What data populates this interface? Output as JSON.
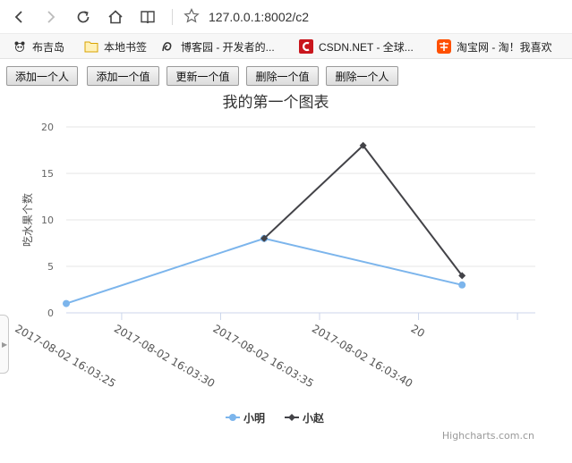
{
  "browser": {
    "url": "127.0.0.1:8002/c2",
    "bookmarks": [
      {
        "label": "布吉岛",
        "icon": "panda-icon"
      },
      {
        "label": "本地书签",
        "icon": "folder-icon"
      },
      {
        "label": "博客园 - 开发者的...",
        "icon": "cnblogs-icon"
      },
      {
        "label": "CSDN.NET - 全球...",
        "icon": "csdn-icon"
      },
      {
        "label": "淘宝网 - 淘！我喜欢",
        "icon": "taobao-icon"
      }
    ]
  },
  "page": {
    "buttons": [
      "添加一个人",
      "添加一个值",
      "更新一个值",
      "删除一个值",
      "删除一个人"
    ]
  },
  "chart_data": {
    "type": "line",
    "title": "我的第一个图表",
    "ylabel": "吃水果个数",
    "ylim": [
      0,
      20
    ],
    "yticks": [
      0,
      5,
      10,
      15,
      20
    ],
    "xticks": [
      "2017-08-02 16:03:25",
      "2017-08-02 16:03:30",
      "2017-08-02 16:03:35",
      "2017-08-02 16:03:40",
      "20"
    ],
    "xrange_seconds": [
      22.2,
      45.9
    ],
    "xtick_seconds": [
      25,
      30,
      35,
      40,
      45
    ],
    "grid": true,
    "legend": "bottom-center",
    "credits": "Highcharts.com.cn",
    "series": [
      {
        "name": "小明",
        "color": "#7cb5ec",
        "marker": "circle",
        "points": [
          {
            "x": "2017-08-02 16:03:22.2",
            "y": 1
          },
          {
            "x": "2017-08-02 16:03:32.2",
            "y": 8
          },
          {
            "x": "2017-08-02 16:03:42.2",
            "y": 3
          }
        ]
      },
      {
        "name": "小赵",
        "color": "#434348",
        "marker": "diamond",
        "points": [
          {
            "x": "2017-08-02 16:03:32.2",
            "y": 8
          },
          {
            "x": "2017-08-02 16:03:37.2",
            "y": 18
          },
          {
            "x": "2017-08-02 16:03:42.2",
            "y": 4
          }
        ]
      }
    ]
  }
}
